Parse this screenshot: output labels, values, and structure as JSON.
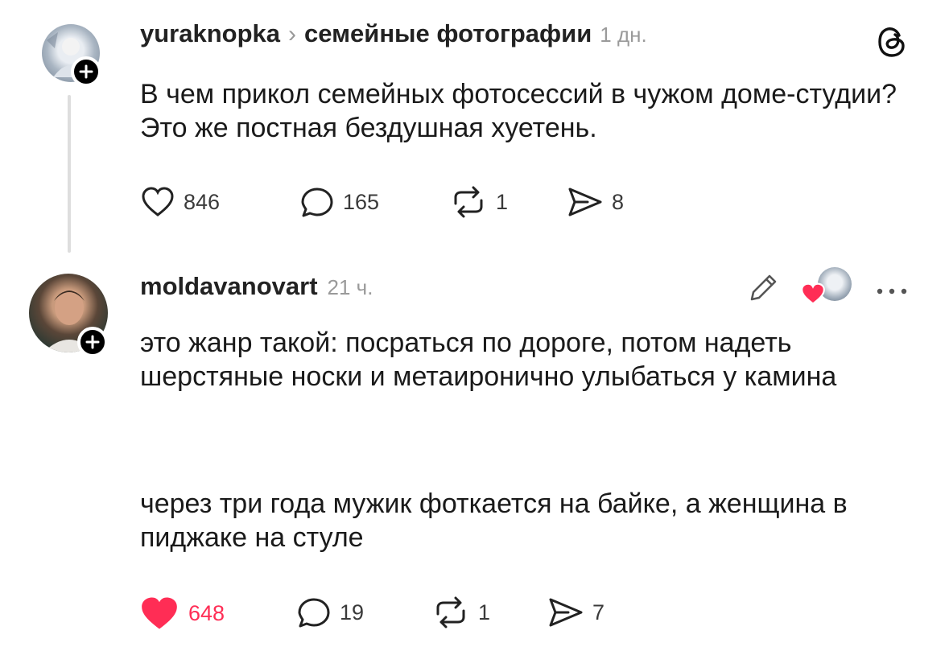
{
  "post": {
    "username": "yuraknopka",
    "topic": "семейные фотографии",
    "time": "1 дн.",
    "text": "В чем прикол семейных фотосессий в чужом доме-студии? Это же постная бездушная хуетень.",
    "likes": "846",
    "comments": "165",
    "reposts": "1",
    "shares": "8"
  },
  "reply": {
    "username": "moldavanovart",
    "time": "21 ч.",
    "paragraph1": "это жанр такой: посраться по дороге, потом надеть шерстяные носки и метаиронично улыбаться у камина",
    "paragraph2": "через три года мужик фоткается на байке, а женщина в пиджаке на стуле",
    "likes": "648",
    "comments": "19",
    "reposts": "1",
    "shares": "7",
    "liked_color": "#ff2d55"
  },
  "icons": [
    "threads-logo-icon",
    "heart-icon",
    "comment-icon",
    "repost-icon",
    "share-icon",
    "pencil-icon",
    "liked-by-author-icon",
    "more-icon",
    "plus-icon"
  ]
}
